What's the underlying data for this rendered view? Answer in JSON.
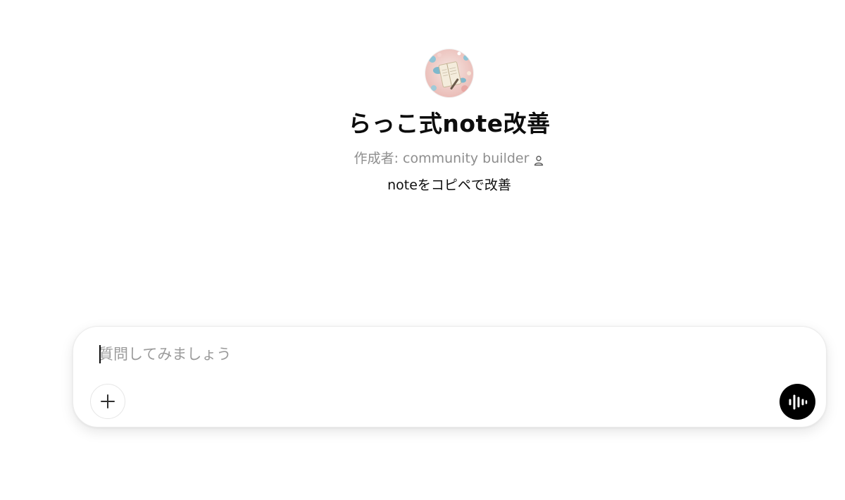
{
  "gpt": {
    "name": "らっこ式note改善",
    "author_label": "作成者: community builder",
    "description": "noteをコピペで改善",
    "avatar_icon": "notebook-illustration-avatar"
  },
  "composer": {
    "placeholder": "質問してみましょう",
    "value": "",
    "add_icon": "plus-icon",
    "voice_icon": "voice-waveform-icon"
  },
  "colors": {
    "text_primary": "#0d0d0d",
    "text_secondary": "#8e8e8e",
    "voice_button_bg": "#000000",
    "composer_border": "#ececec"
  }
}
